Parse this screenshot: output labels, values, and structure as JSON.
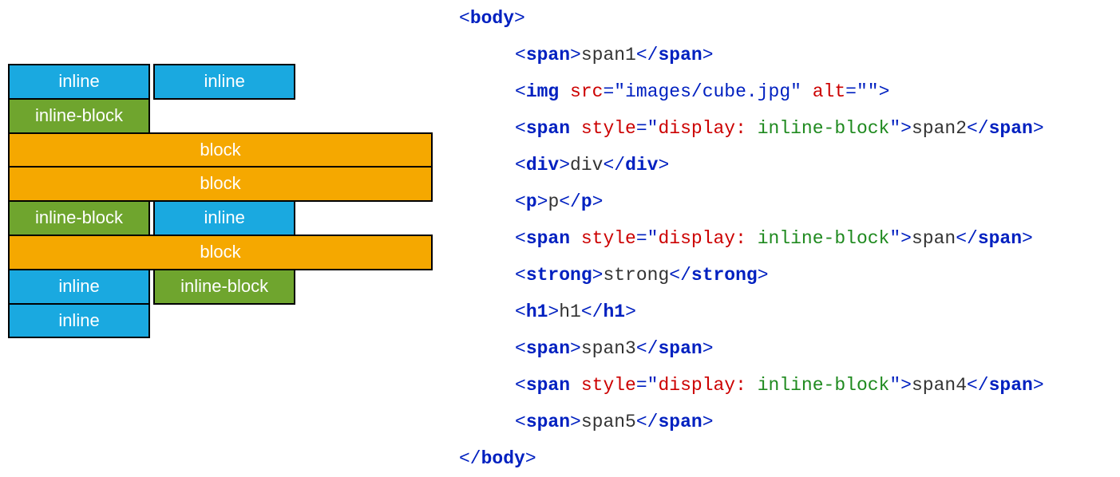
{
  "diagram": {
    "row1": {
      "c1": "inline",
      "c2": "inline",
      "c3": "inline-block"
    },
    "row2": {
      "c1": "block"
    },
    "row3": {
      "c1": "block"
    },
    "row4": {
      "c1": "inline-block",
      "c2": "inline"
    },
    "row5": {
      "c1": "block"
    },
    "row6": {
      "c1": "inline",
      "c2": "inline-block",
      "c3": "inline"
    }
  },
  "code": {
    "body_open_ang1": "<",
    "body_open_name": "body",
    "body_open_ang2": ">",
    "body_close_ang1": "</",
    "body_close_name": "body",
    "body_close_ang2": ">",
    "line1": {
      "ang1": "<",
      "tag": "span",
      "ang2": ">",
      "text": "span1",
      "ang3": "</",
      "tag2": "span",
      "ang4": ">"
    },
    "line2": {
      "ang1": "<",
      "tag": "img",
      "sp1": " ",
      "attr1": "src",
      "eq1": "=",
      "val1": "\"images/cube.jpg\"",
      "sp2": " ",
      "attr2": "alt",
      "eq2": "=",
      "val2": "\"\"",
      "ang2": ">"
    },
    "line3": {
      "ang1": "<",
      "tag": "span",
      "sp": " ",
      "attr": "style",
      "eq": "=",
      "q1": "\"",
      "prop": "display:",
      "psp": " ",
      "pval": "inline-block",
      "q2": "\"",
      "ang2": ">",
      "text": "span2",
      "ang3": "</",
      "tag2": "span",
      "ang4": ">"
    },
    "line4": {
      "ang1": "<",
      "tag": "div",
      "ang2": ">",
      "text": "div",
      "ang3": "</",
      "tag2": "div",
      "ang4": ">"
    },
    "line5": {
      "ang1": "<",
      "tag": "p",
      "ang2": ">",
      "text": "p",
      "ang3": "</",
      "tag2": "p",
      "ang4": ">"
    },
    "line6": {
      "ang1": "<",
      "tag": "span",
      "sp": " ",
      "attr": "style",
      "eq": "=",
      "q1": "\"",
      "prop": "display:",
      "psp": " ",
      "pval": "inline-block",
      "q2": "\"",
      "ang2": ">",
      "text": "span",
      "ang3": "</",
      "tag2": "span",
      "ang4": ">"
    },
    "line7": {
      "ang1": "<",
      "tag": "strong",
      "ang2": ">",
      "text": "strong",
      "ang3": "</",
      "tag2": "strong",
      "ang4": ">"
    },
    "line8": {
      "ang1": "<",
      "tag": "h1",
      "ang2": ">",
      "text": "h1",
      "ang3": "</",
      "tag2": "h1",
      "ang4": ">"
    },
    "line9": {
      "ang1": "<",
      "tag": "span",
      "ang2": ">",
      "text": "span3",
      "ang3": "</",
      "tag2": "span",
      "ang4": ">"
    },
    "line10": {
      "ang1": "<",
      "tag": "span",
      "sp": " ",
      "attr": "style",
      "eq": "=",
      "q1": "\"",
      "prop": "display:",
      "psp": " ",
      "pval": "inline-block",
      "q2": "\"",
      "ang2": ">",
      "text": "span4",
      "ang3": "</",
      "tag2": "span",
      "ang4": ">"
    },
    "line11": {
      "ang1": "<",
      "tag": "span",
      "ang2": ">",
      "text": "span5",
      "ang3": "</",
      "tag2": "span",
      "ang4": ">"
    }
  }
}
